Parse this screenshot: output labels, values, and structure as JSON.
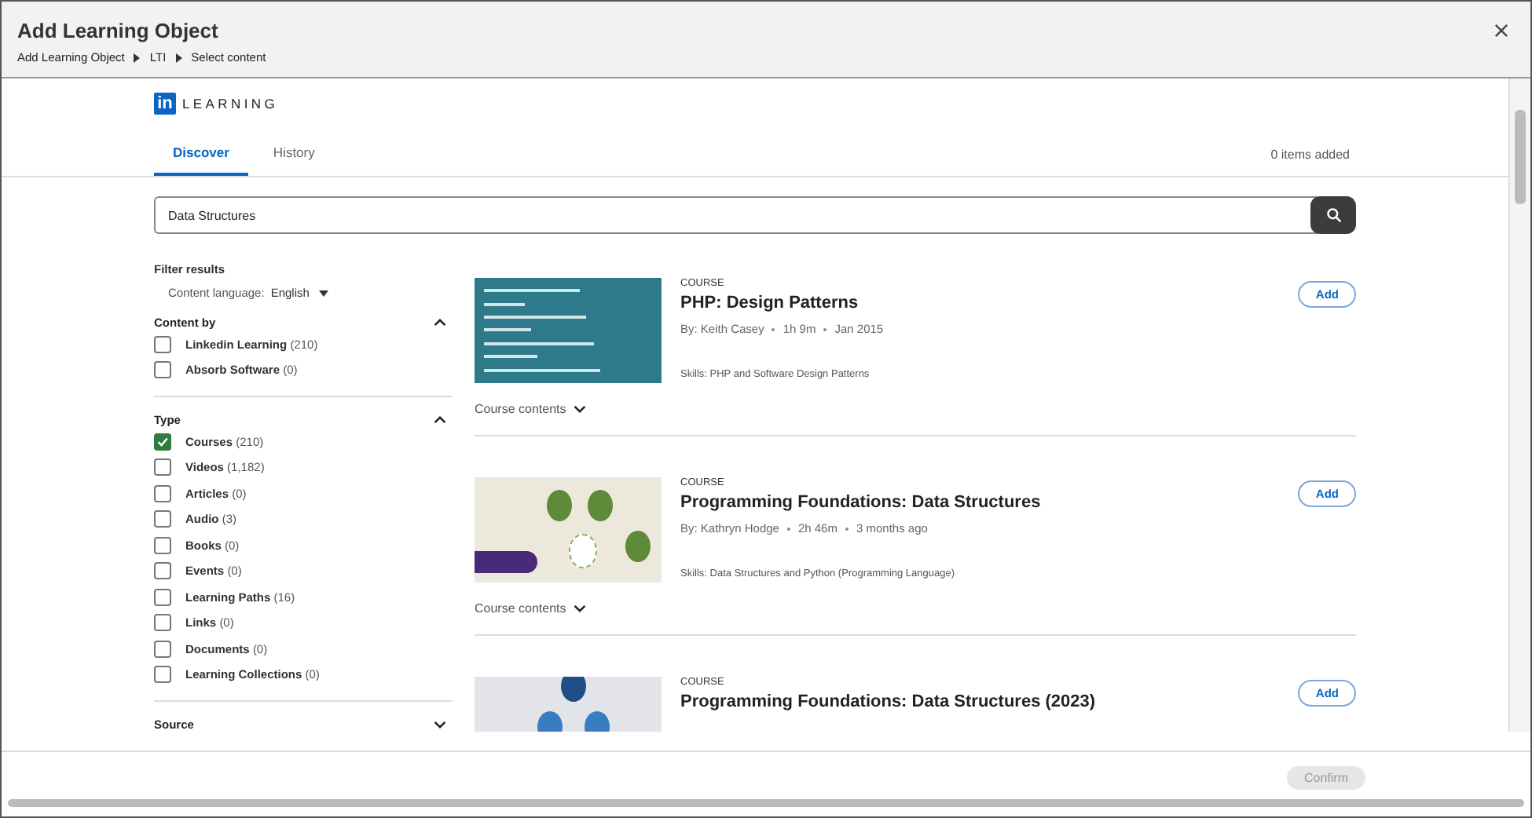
{
  "window": {
    "title": "Add Learning Object",
    "breadcrumb": [
      "Add Learning Object",
      "LTI",
      "Select content"
    ]
  },
  "brand": {
    "logo_text": "in",
    "name": "LEARNING"
  },
  "tabs": [
    {
      "label": "Discover",
      "selected": true
    },
    {
      "label": "History",
      "selected": false
    }
  ],
  "items_added": "0 items added",
  "search": {
    "value": "Data Structures"
  },
  "filters": {
    "heading": "Filter results",
    "language_label": "Content language:",
    "language_value": "English",
    "groups": [
      {
        "title": "Content by",
        "expanded": true,
        "options": [
          {
            "label": "Linkedin Learning",
            "count": "(210)",
            "checked": false
          },
          {
            "label": "Absorb Software",
            "count": "(0)",
            "checked": false
          }
        ]
      },
      {
        "title": "Type",
        "expanded": true,
        "options": [
          {
            "label": "Courses",
            "count": "(210)",
            "checked": true
          },
          {
            "label": "Videos",
            "count": "(1,182)",
            "checked": false
          },
          {
            "label": "Articles",
            "count": "(0)",
            "checked": false
          },
          {
            "label": "Audio",
            "count": "(3)",
            "checked": false
          },
          {
            "label": "Books",
            "count": "(0)",
            "checked": false
          },
          {
            "label": "Events",
            "count": "(0)",
            "checked": false
          },
          {
            "label": "Learning Paths",
            "count": "(16)",
            "checked": false
          },
          {
            "label": "Links",
            "count": "(0)",
            "checked": false
          },
          {
            "label": "Documents",
            "count": "(0)",
            "checked": false
          },
          {
            "label": "Learning Collections",
            "count": "(0)",
            "checked": false
          }
        ]
      },
      {
        "title": "Source",
        "expanded": false
      }
    ]
  },
  "results": [
    {
      "kind": "code",
      "type": "COURSE",
      "title": "PHP: Design Patterns",
      "meta": [
        "By: Keith Casey",
        "1h 9m",
        "Jan 2015"
      ],
      "skills": "Skills: PHP and Software Design Patterns",
      "contents": "Course contents",
      "add": "Add"
    },
    {
      "kind": "tree",
      "type": "COURSE",
      "title": "Programming Foundations: Data Structures",
      "meta": [
        "By: Kathryn Hodge",
        "2h 46m",
        "3 months ago"
      ],
      "skills": "Skills: Data Structures and Python (Programming Language)",
      "contents": "Course contents",
      "add": "Add"
    },
    {
      "kind": "tree-blue",
      "type": "COURSE",
      "title": "Programming Foundations: Data Structures (2023)",
      "add": "Add"
    }
  ],
  "footer": {
    "confirm": "Confirm",
    "confirm_disabled": true
  }
}
